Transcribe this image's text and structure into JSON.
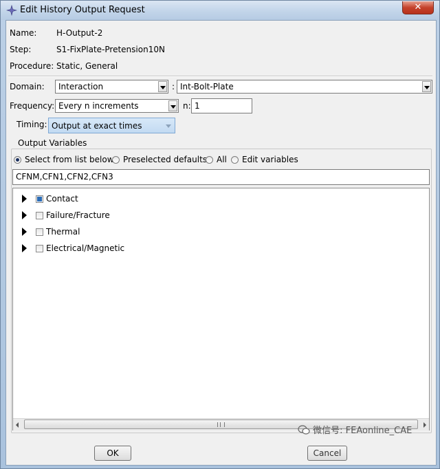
{
  "window": {
    "title": "Edit History Output Request",
    "close_glyph": "✕"
  },
  "info": {
    "name_label": "Name:",
    "name_value": "H-Output-2",
    "step_label": "Step:",
    "step_value": "S1-FixPlate-Pretension10N",
    "procedure_label": "Procedure:",
    "procedure_value": "Static, General"
  },
  "domain": {
    "label": "Domain:",
    "value": "Interaction",
    "separator": ":",
    "target": "Int-Bolt-Plate"
  },
  "frequency": {
    "label": "Frequency:",
    "value": "Every n increments",
    "n_label": "n:",
    "n_value": "1"
  },
  "timing": {
    "label": "Timing:",
    "value": "Output at exact times"
  },
  "output_variables": {
    "title": "Output Variables",
    "options": [
      "Select from list below",
      "Preselected defaults",
      "All",
      "Edit variables"
    ],
    "selected_index": 0,
    "text": "CFNM,CFN1,CFN2,CFN3",
    "tree": [
      {
        "label": "Contact",
        "state": "partial"
      },
      {
        "label": "Failure/Fracture",
        "state": "unchecked"
      },
      {
        "label": "Thermal",
        "state": "unchecked"
      },
      {
        "label": "Electrical/Magnetic",
        "state": "unchecked"
      }
    ]
  },
  "buttons": {
    "ok": "OK",
    "cancel": "Cancel"
  },
  "watermark": "微信号: FEAonline_CAE",
  "colors": {
    "title_bar": "#c4d6ea",
    "dialog_bg": "#f0f0f0",
    "check_fill": "#2b6db8",
    "close_btn": "#c4422b"
  }
}
